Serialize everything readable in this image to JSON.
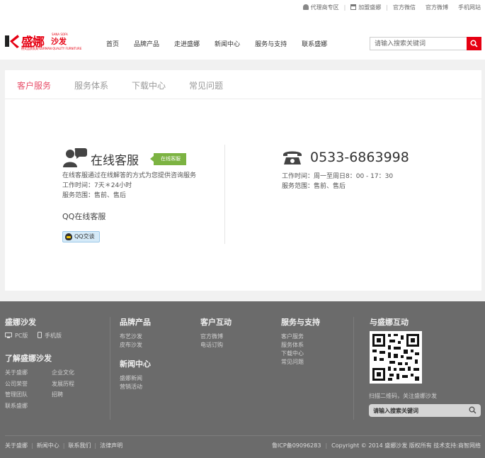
{
  "topbar": {
    "agent_zone": "代理商专区",
    "join": "加盟盛娜",
    "wechat": "官方微信",
    "weibo": "官方微博",
    "mobile_site": "手机网站"
  },
  "logo": {
    "brand": "盛娜",
    "product": "沙发",
    "en": "SANA SOFA",
    "tagline": "德式品质家具·GERMAN QUALITY FURNITURE"
  },
  "nav": {
    "items": [
      {
        "label": "首页"
      },
      {
        "label": "品牌产品"
      },
      {
        "label": "走进盛娜"
      },
      {
        "label": "新闻中心"
      },
      {
        "label": "服务与支持"
      },
      {
        "label": "联系盛娜"
      }
    ]
  },
  "search": {
    "placeholder": "请输入搜索关键词"
  },
  "tabs": [
    {
      "label": "客户服务",
      "active": true
    },
    {
      "label": "服务体系"
    },
    {
      "label": "下载中心"
    },
    {
      "label": "常见问题"
    }
  ],
  "online_service": {
    "title": "在线客服",
    "badge": "在线客服",
    "desc": "在线客服通过在线解答的方式为您提供咨询服务",
    "hours": "工作时间：7天＊24小时",
    "scope": "服务范围：售前、售后",
    "qq_title": "QQ在线客服",
    "qq_button": "QQ交谈"
  },
  "phone_service": {
    "number": "0533-6863998",
    "hours": "工作时间：周一至周日8：00 - 17：30",
    "scope": "服务范围：售前、售后"
  },
  "footer": {
    "col1": {
      "title": "盛娜沙发",
      "pc": "PC版",
      "mobile": "手机版",
      "title2": "了解盛娜沙发",
      "links_a": [
        "关于盛娜",
        "公司荣誉",
        "管理团队",
        "联系盛娜"
      ],
      "links_b": [
        "企业文化",
        "发展历程",
        "招聘"
      ]
    },
    "col2": {
      "title": "品牌产品",
      "links": [
        "布艺沙发",
        "皮布沙发"
      ],
      "title2": "新闻中心",
      "links2": [
        "盛娜新闻",
        "营销活动"
      ]
    },
    "col3": {
      "title": "客户互动",
      "links": [
        "官方微博",
        "电话订购"
      ]
    },
    "col4": {
      "title": "服务与支持",
      "links": [
        "客户服务",
        "服务体系",
        "下载中心",
        "常见问题"
      ]
    },
    "col5": {
      "title": "与盛娜互动",
      "qr_note": "扫描二维码，关注盛娜沙发",
      "search_placeholder": "请输入搜索关键词"
    },
    "bottom_links": [
      "关于盛娜",
      "新闻中心",
      "联系我们",
      "法律声明"
    ],
    "icp": "鲁ICP备09096283",
    "copyright": "Copyright © 2014 盛娜沙发 版权所有 技术支持:商智网络"
  },
  "colors": {
    "accent": "#e60012",
    "tab_active": "#e8506a",
    "badge": "#7cb342",
    "footer_bg": "#6b6b6b"
  }
}
